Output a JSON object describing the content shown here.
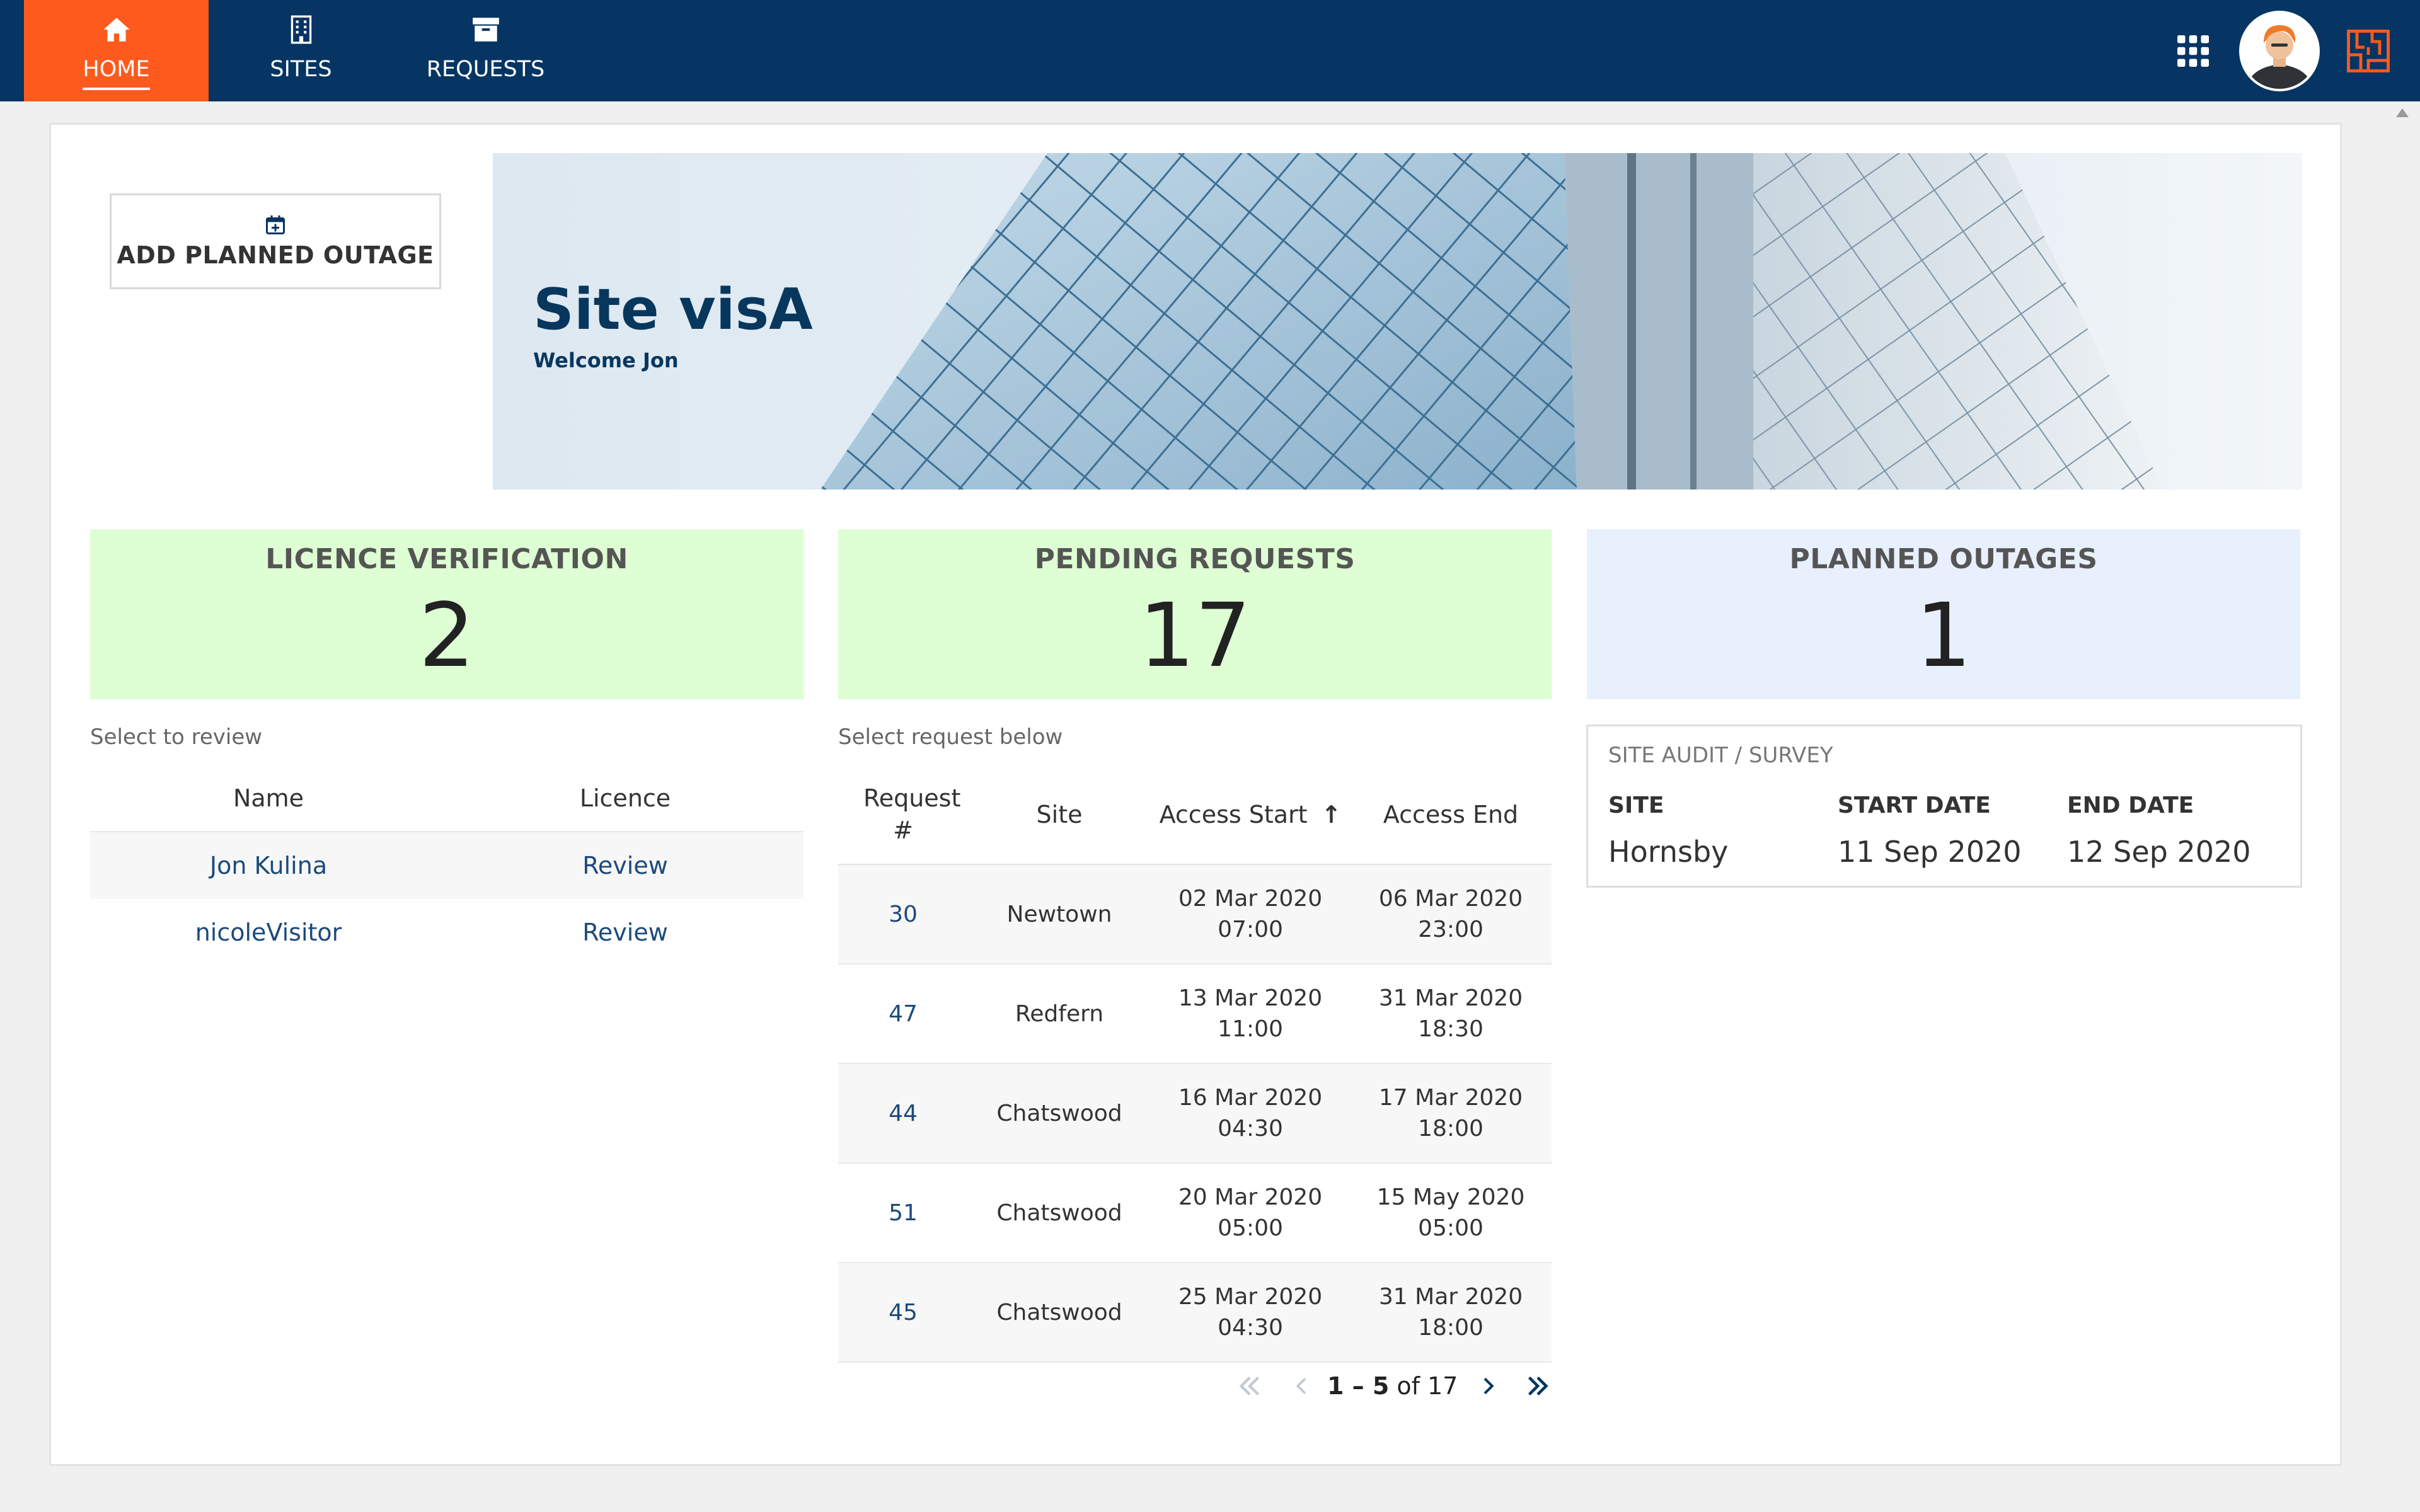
{
  "nav": {
    "tabs": [
      {
        "label": "HOME",
        "icon": "home-icon"
      },
      {
        "label": "SITES",
        "icon": "building-icon"
      },
      {
        "label": "REQUESTS",
        "icon": "archive-box-icon"
      }
    ],
    "active_tab": "HOME",
    "right_icons": [
      "apps-grid-icon",
      "user-avatar",
      "brand-logo-icon"
    ]
  },
  "actions": {
    "add_outage_label": "ADD PLANNED OUTAGE",
    "add_outage_icon": "calendar-plus-icon"
  },
  "hero": {
    "title": "Site visA",
    "welcome": "Welcome Jon"
  },
  "tiles": {
    "licence": {
      "title": "LICENCE VERIFICATION",
      "count": "2"
    },
    "pending": {
      "title": "PENDING REQUESTS",
      "count": "17"
    },
    "outages": {
      "title": "PLANNED OUTAGES",
      "count": "1"
    }
  },
  "licence_table": {
    "hint": "Select to review",
    "headers": [
      "Name",
      "Licence"
    ],
    "rows": [
      {
        "name": "Jon Kulina",
        "action": "Review"
      },
      {
        "name": "nicoleVisitor",
        "action": "Review"
      }
    ]
  },
  "requests_table": {
    "hint": "Select request below",
    "headers": [
      "Request #",
      "Site",
      "Access Start",
      "Access End"
    ],
    "sort_indicator": "↑",
    "rows": [
      {
        "id": "30",
        "site": "Newtown",
        "start_date": "02 Mar 2020",
        "start_time": "07:00",
        "end_date": "06 Mar 2020",
        "end_time": "23:00"
      },
      {
        "id": "47",
        "site": "Redfern",
        "start_date": "13 Mar 2020",
        "start_time": "11:00",
        "end_date": "31 Mar 2020",
        "end_time": "18:30"
      },
      {
        "id": "44",
        "site": "Chatswood",
        "start_date": "16 Mar 2020",
        "start_time": "04:30",
        "end_date": "17 Mar 2020",
        "end_time": "18:00"
      },
      {
        "id": "51",
        "site": "Chatswood",
        "start_date": "20 Mar 2020",
        "start_time": "05:00",
        "end_date": "15 May 2020",
        "end_time": "05:00"
      },
      {
        "id": "45",
        "site": "Chatswood",
        "start_date": "25 Mar 2020",
        "start_time": "04:30",
        "end_date": "31 Mar 2020",
        "end_time": "18:00"
      }
    ],
    "pager": {
      "range": "1 – 5",
      "of": "of",
      "total": "17"
    }
  },
  "site_audit": {
    "title": "SITE AUDIT / SURVEY",
    "headers": [
      "SITE",
      "START DATE",
      "END DATE"
    ],
    "row": {
      "site": "Hornsby",
      "start": "11 Sep 2020",
      "end": "12 Sep 2020"
    }
  },
  "colors": {
    "nav_bg": "#063563",
    "active_tab": "#fe5a1d",
    "tile_green": "#defed4",
    "tile_blue": "#e8f0fe",
    "link": "#1c4a7b",
    "hero_title": "#08375e"
  }
}
